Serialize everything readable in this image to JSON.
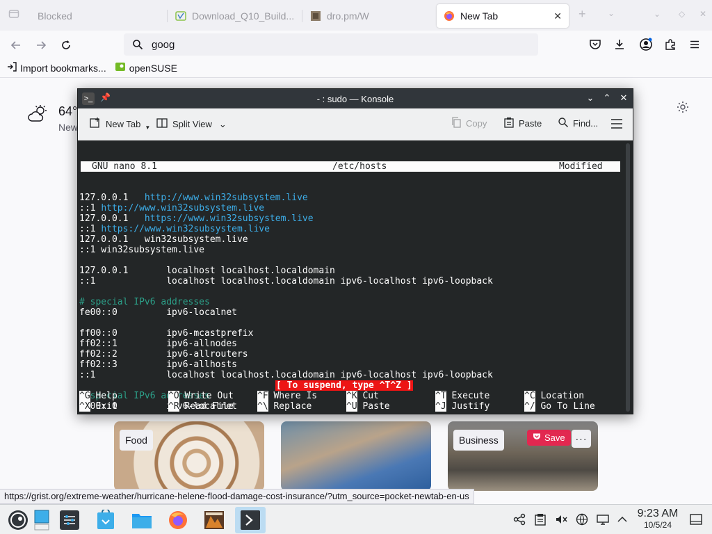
{
  "browser": {
    "tabs": [
      {
        "label": "Blocked",
        "active": false
      },
      {
        "label": "Download_Q10_Build...",
        "active": false
      },
      {
        "label": "dro.pm/W",
        "active": false
      },
      {
        "label": "New Tab",
        "active": true
      }
    ],
    "url_value": "goog",
    "bookmarks": [
      {
        "label": "Import bookmarks..."
      },
      {
        "label": "openSUSE"
      }
    ]
  },
  "newtab": {
    "weather_temp": "64°",
    "weather_location": "New",
    "cards": [
      {
        "tag": "Food"
      },
      {
        "tag": ""
      },
      {
        "tag": "Business"
      }
    ],
    "save_label": "Save",
    "more_label": "···"
  },
  "status_url": "https://grist.org/extreme-weather/hurricane-helene-flood-damage-cost-insurance/?utm_source=pocket-newtab-en-us",
  "konsole": {
    "title": "- : sudo — Konsole",
    "toolbar": {
      "new_tab": "New Tab",
      "split_view": "Split View",
      "copy": "Copy",
      "paste": "Paste",
      "find": "Find..."
    },
    "nano": {
      "version": "GNU nano 8.1",
      "filename": "/etc/hosts",
      "state": "Modified",
      "lines": [
        {
          "a": "127.0.0.1   ",
          "b": "http://www.win32subsystem.live",
          "kind": "url"
        },
        {
          "a": "::1 ",
          "b": "http://www.win32subsystem.live",
          "kind": "url"
        },
        {
          "a": "127.0.0.1   ",
          "b": "https://www.win32subsystem.live",
          "kind": "url"
        },
        {
          "a": "::1 ",
          "b": "https://www.win32subsystem.live",
          "kind": "url"
        },
        {
          "a": "127.0.0.1   win32subsystem.live",
          "b": "",
          "kind": "plain"
        },
        {
          "a": "::1 win32subsystem.live",
          "b": "",
          "kind": "plain"
        },
        {
          "a": "",
          "b": "",
          "kind": "plain"
        },
        {
          "a": "127.0.0.1       localhost localhost.localdomain",
          "b": "",
          "kind": "plain"
        },
        {
          "a": "::1             localhost localhost.localdomain ipv6-localhost ipv6-loopback",
          "b": "",
          "kind": "plain"
        },
        {
          "a": "",
          "b": "",
          "kind": "plain"
        },
        {
          "a": "# special IPv6 addresses",
          "b": "",
          "kind": "comment"
        },
        {
          "a": "fe00::0         ipv6-localnet",
          "b": "",
          "kind": "plain"
        },
        {
          "a": "",
          "b": "",
          "kind": "plain"
        },
        {
          "a": "ff00::0         ipv6-mcastprefix",
          "b": "",
          "kind": "plain"
        },
        {
          "a": "ff02::1         ipv6-allnodes",
          "b": "",
          "kind": "plain"
        },
        {
          "a": "ff02::2         ipv6-allrouters",
          "b": "",
          "kind": "plain"
        },
        {
          "a": "ff02::3         ipv6-allhosts",
          "b": "",
          "kind": "plain"
        },
        {
          "a": "::1             localhost localhost.localdomain ipv6-localhost ipv6-loopback",
          "b": "",
          "kind": "plain"
        },
        {
          "a": "",
          "b": "",
          "kind": "plain"
        },
        {
          "a": "# special IPv6 addresses",
          "b": "",
          "kind": "comment"
        },
        {
          "a": "fe00::0         ipv6-localnet",
          "b": "",
          "kind": "plain"
        }
      ],
      "alert": "[ To suspend, type ^T^Z ]",
      "shortcuts_row1": [
        {
          "key": "^G",
          "label": "Help"
        },
        {
          "key": "^O",
          "label": "Write Out"
        },
        {
          "key": "^F",
          "label": "Where Is"
        },
        {
          "key": "^K",
          "label": "Cut"
        },
        {
          "key": "^T",
          "label": "Execute"
        },
        {
          "key": "^C",
          "label": "Location"
        }
      ],
      "shortcuts_row2": [
        {
          "key": "^X",
          "label": "Exit"
        },
        {
          "key": "^R",
          "label": "Read File"
        },
        {
          "key": "^\\",
          "label": "Replace"
        },
        {
          "key": "^U",
          "label": "Paste"
        },
        {
          "key": "^J",
          "label": "Justify"
        },
        {
          "key": "^/",
          "label": "Go To Line"
        }
      ]
    }
  },
  "taskbar": {
    "time": "9:23 AM",
    "date": "10/5/24"
  },
  "colors": {
    "terminal_bg": "#232627",
    "url_blue": "#3daee9",
    "comment_green": "#2ca089",
    "alert_red": "#ed1515",
    "save_red": "#e22850",
    "active_task": "#bcdcf2"
  }
}
